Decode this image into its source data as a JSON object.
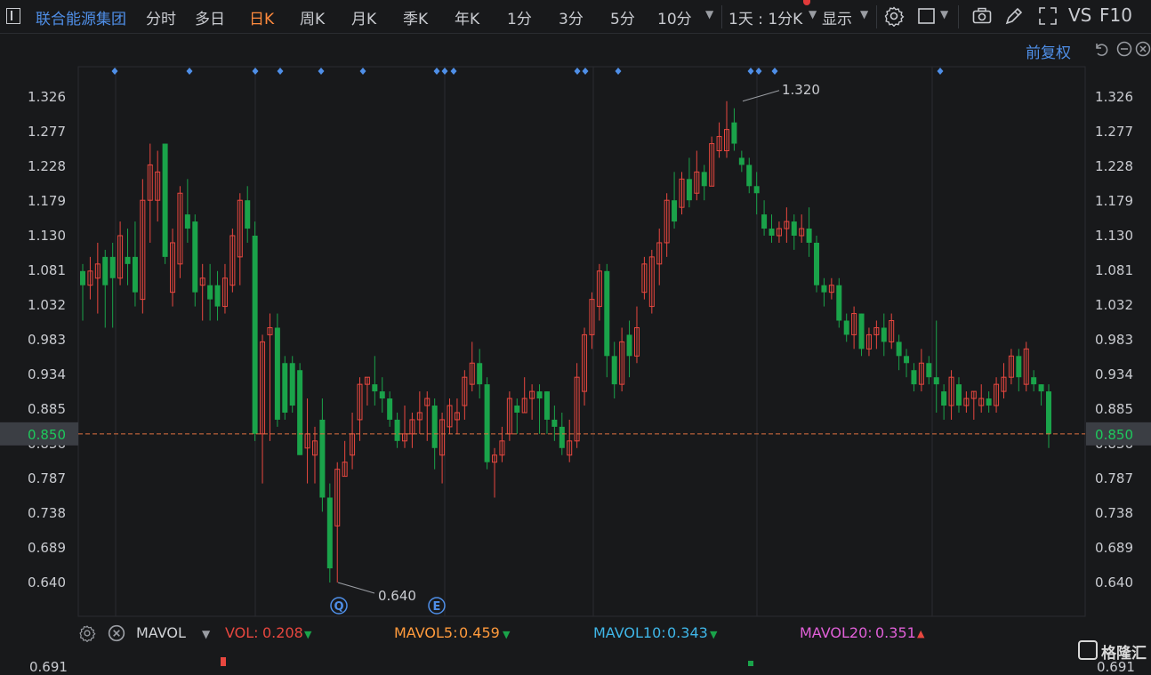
{
  "toolbar": {
    "stock_name": "联合能源集团",
    "periods": [
      "分时",
      "多日",
      "日K",
      "周K",
      "月K",
      "季K",
      "年K",
      "1分",
      "3分",
      "5分",
      "10分"
    ],
    "active_period": "日K",
    "kline_setting": "1天 : 1分K",
    "display_label": "显示",
    "vs_label": "VS",
    "f10_label": "F10"
  },
  "adjust_label": "前复权",
  "colors": {
    "up": "#e8473f",
    "down": "#1aa34a",
    "marker": "#4f8fe8",
    "current_price_line": "#e07040",
    "current_price_badge_bg": "#3b3e44",
    "current_price_text": "#1ec95c",
    "mavol5": "#ff9a3c",
    "mavol10": "#3fb6e8",
    "mavol20": "#e060d8",
    "vol": "#e8473f"
  },
  "icons": [
    "settings-icon",
    "fullscreen-icon",
    "screenshot-icon",
    "draw-icon",
    "undo-icon",
    "zoom-out-icon",
    "close-icon",
    "gear-icon"
  ],
  "chart_data": {
    "type": "candlestick",
    "y_ticks": [
      "1.326",
      "1.277",
      "1.228",
      "1.179",
      "1.130",
      "1.081",
      "1.032",
      "0.983",
      "0.934",
      "0.885",
      "0.836",
      "0.787",
      "0.738",
      "0.689",
      "0.640"
    ],
    "ylim": [
      0.61,
      1.355
    ],
    "current_price": "0.850",
    "high_annotation": "1.320",
    "low_annotation": "0.640",
    "event_markers": [
      "Q",
      "E"
    ],
    "candles": [
      [
        1.08,
        1.06,
        1.09,
        1.01
      ],
      [
        1.06,
        1.08,
        1.1,
        1.04
      ],
      [
        1.07,
        1.09,
        1.12,
        1.02
      ],
      [
        1.1,
        1.06,
        1.11,
        1.0
      ],
      [
        1.1,
        1.07,
        1.12,
        1.0
      ],
      [
        1.07,
        1.13,
        1.15,
        1.06
      ],
      [
        1.1,
        1.09,
        1.14,
        1.06
      ],
      [
        1.1,
        1.05,
        1.15,
        1.03
      ],
      [
        1.04,
        1.18,
        1.21,
        1.02
      ],
      [
        1.18,
        1.23,
        1.26,
        1.12
      ],
      [
        1.18,
        1.22,
        1.25,
        1.15
      ],
      [
        1.26,
        1.1,
        1.26,
        1.09
      ],
      [
        1.05,
        1.12,
        1.14,
        1.03
      ],
      [
        1.09,
        1.19,
        1.2,
        1.07
      ],
      [
        1.16,
        1.14,
        1.21,
        1.12
      ],
      [
        1.15,
        1.05,
        1.16,
        1.03
      ],
      [
        1.06,
        1.07,
        1.09,
        1.01
      ],
      [
        1.06,
        1.04,
        1.09,
        1.01
      ],
      [
        1.06,
        1.03,
        1.08,
        1.01
      ],
      [
        1.03,
        1.07,
        1.09,
        1.02
      ],
      [
        1.06,
        1.13,
        1.14,
        1.05
      ],
      [
        1.1,
        1.18,
        1.19,
        1.06
      ],
      [
        1.18,
        1.14,
        1.2,
        1.12
      ],
      [
        1.13,
        0.85,
        1.15,
        0.84
      ],
      [
        0.85,
        0.98,
        0.99,
        0.78
      ],
      [
        0.99,
        1.0,
        1.02,
        0.84
      ],
      [
        1.0,
        0.87,
        1.02,
        0.86
      ],
      [
        0.95,
        0.88,
        0.96,
        0.87
      ],
      [
        0.95,
        0.89,
        0.96,
        0.88
      ],
      [
        0.94,
        0.82,
        0.95,
        0.82
      ],
      [
        0.83,
        0.85,
        0.9,
        0.78
      ],
      [
        0.82,
        0.84,
        0.86,
        0.78
      ],
      [
        0.87,
        0.76,
        0.9,
        0.74
      ],
      [
        0.76,
        0.66,
        0.78,
        0.64
      ],
      [
        0.72,
        0.8,
        0.81,
        0.64
      ],
      [
        0.79,
        0.81,
        0.84,
        0.79
      ],
      [
        0.82,
        0.85,
        0.88,
        0.8
      ],
      [
        0.87,
        0.92,
        0.93,
        0.84
      ],
      [
        0.92,
        0.93,
        0.93,
        0.89
      ],
      [
        0.92,
        0.91,
        0.96,
        0.89
      ],
      [
        0.91,
        0.9,
        0.93,
        0.88
      ],
      [
        0.9,
        0.87,
        0.91,
        0.86
      ],
      [
        0.87,
        0.84,
        0.88,
        0.83
      ],
      [
        0.84,
        0.85,
        0.89,
        0.83
      ],
      [
        0.85,
        0.87,
        0.88,
        0.83
      ],
      [
        0.87,
        0.88,
        0.91,
        0.85
      ],
      [
        0.89,
        0.9,
        0.91,
        0.84
      ],
      [
        0.89,
        0.83,
        0.9,
        0.8
      ],
      [
        0.82,
        0.87,
        0.88,
        0.78
      ],
      [
        0.86,
        0.89,
        0.9,
        0.85
      ],
      [
        0.87,
        0.88,
        0.9,
        0.85
      ],
      [
        0.89,
        0.93,
        0.94,
        0.87
      ],
      [
        0.92,
        0.95,
        0.98,
        0.91
      ],
      [
        0.95,
        0.92,
        0.97,
        0.9
      ],
      [
        0.92,
        0.81,
        0.93,
        0.8
      ],
      [
        0.81,
        0.82,
        0.83,
        0.76
      ],
      [
        0.82,
        0.84,
        0.86,
        0.81
      ],
      [
        0.85,
        0.9,
        0.91,
        0.84
      ],
      [
        0.89,
        0.88,
        0.9,
        0.85
      ],
      [
        0.88,
        0.9,
        0.93,
        0.88
      ],
      [
        0.9,
        0.91,
        0.92,
        0.87
      ],
      [
        0.91,
        0.9,
        0.92,
        0.85
      ],
      [
        0.91,
        0.87,
        0.91,
        0.85
      ],
      [
        0.87,
        0.86,
        0.89,
        0.84
      ],
      [
        0.86,
        0.83,
        0.88,
        0.82
      ],
      [
        0.82,
        0.84,
        0.87,
        0.81
      ],
      [
        0.84,
        0.93,
        0.95,
        0.83
      ],
      [
        0.91,
        0.99,
        1.0,
        0.89
      ],
      [
        0.99,
        1.04,
        1.05,
        0.97
      ],
      [
        1.03,
        1.08,
        1.09,
        1.01
      ],
      [
        1.08,
        0.96,
        1.09,
        0.93
      ],
      [
        0.96,
        0.92,
        0.98,
        0.9
      ],
      [
        0.92,
        0.98,
        1.0,
        0.91
      ],
      [
        0.99,
        0.96,
        1.01,
        0.93
      ],
      [
        0.96,
        1.0,
        1.03,
        0.95
      ],
      [
        1.05,
        1.09,
        1.1,
        1.04
      ],
      [
        1.03,
        1.1,
        1.11,
        1.02
      ],
      [
        1.09,
        1.12,
        1.14,
        1.06
      ],
      [
        1.12,
        1.18,
        1.19,
        1.1
      ],
      [
        1.18,
        1.15,
        1.22,
        1.14
      ],
      [
        1.17,
        1.21,
        1.22,
        1.16
      ],
      [
        1.21,
        1.18,
        1.24,
        1.17
      ],
      [
        1.19,
        1.22,
        1.25,
        1.18
      ],
      [
        1.22,
        1.2,
        1.23,
        1.18
      ],
      [
        1.2,
        1.26,
        1.27,
        1.2
      ],
      [
        1.25,
        1.27,
        1.29,
        1.24
      ],
      [
        1.25,
        1.28,
        1.32,
        1.24
      ],
      [
        1.29,
        1.26,
        1.31,
        1.25
      ],
      [
        1.24,
        1.23,
        1.25,
        1.22
      ],
      [
        1.23,
        1.2,
        1.24,
        1.19
      ],
      [
        1.2,
        1.19,
        1.22,
        1.16
      ],
      [
        1.16,
        1.14,
        1.18,
        1.13
      ],
      [
        1.14,
        1.13,
        1.16,
        1.12
      ],
      [
        1.13,
        1.14,
        1.15,
        1.12
      ],
      [
        1.14,
        1.15,
        1.17,
        1.12
      ],
      [
        1.15,
        1.13,
        1.16,
        1.11
      ],
      [
        1.13,
        1.14,
        1.16,
        1.12
      ],
      [
        1.14,
        1.12,
        1.17,
        1.1
      ],
      [
        1.12,
        1.06,
        1.13,
        1.05
      ],
      [
        1.06,
        1.05,
        1.07,
        1.03
      ],
      [
        1.05,
        1.06,
        1.07,
        1.04
      ],
      [
        1.06,
        1.01,
        1.07,
        1.0
      ],
      [
        1.01,
        0.99,
        1.02,
        0.98
      ],
      [
        0.99,
        1.02,
        1.03,
        0.97
      ],
      [
        1.02,
        0.97,
        1.02,
        0.96
      ],
      [
        0.97,
        0.99,
        1.0,
        0.96
      ],
      [
        0.99,
        1.0,
        1.01,
        0.97
      ],
      [
        1.0,
        0.98,
        1.02,
        0.96
      ],
      [
        0.98,
        1.01,
        1.02,
        0.97
      ],
      [
        0.98,
        0.96,
        0.99,
        0.94
      ],
      [
        0.96,
        0.95,
        0.97,
        0.93
      ],
      [
        0.94,
        0.92,
        0.95,
        0.91
      ],
      [
        0.92,
        0.95,
        0.97,
        0.91
      ],
      [
        0.95,
        0.93,
        0.96,
        0.92
      ],
      [
        0.93,
        0.92,
        1.01,
        0.88
      ],
      [
        0.91,
        0.89,
        0.92,
        0.87
      ],
      [
        0.89,
        0.93,
        0.94,
        0.87
      ],
      [
        0.92,
        0.89,
        0.93,
        0.88
      ],
      [
        0.89,
        0.9,
        0.91,
        0.88
      ],
      [
        0.9,
        0.91,
        0.91,
        0.87
      ],
      [
        0.89,
        0.9,
        0.92,
        0.88
      ],
      [
        0.9,
        0.89,
        0.91,
        0.88
      ],
      [
        0.89,
        0.92,
        0.93,
        0.88
      ],
      [
        0.91,
        0.93,
        0.95,
        0.9
      ],
      [
        0.93,
        0.96,
        0.97,
        0.92
      ],
      [
        0.96,
        0.93,
        0.97,
        0.91
      ],
      [
        0.92,
        0.97,
        0.98,
        0.91
      ],
      [
        0.93,
        0.92,
        0.94,
        0.91
      ],
      [
        0.92,
        0.91,
        0.92,
        0.89
      ],
      [
        0.91,
        0.85,
        0.92,
        0.83
      ]
    ]
  },
  "volume_panel": {
    "indicator": "MAVOL",
    "vol_label": "VOL:",
    "vol_value": "0.208",
    "mavol5_label": "MAVOL5:",
    "mavol5_value": "0.459",
    "mavol10_label": "MAVOL10:",
    "mavol10_value": "0.343",
    "mavol20_label": "MAVOL20:",
    "mavol20_value": "0.351",
    "lower_tick": "0.691"
  },
  "watermark": "格隆汇"
}
